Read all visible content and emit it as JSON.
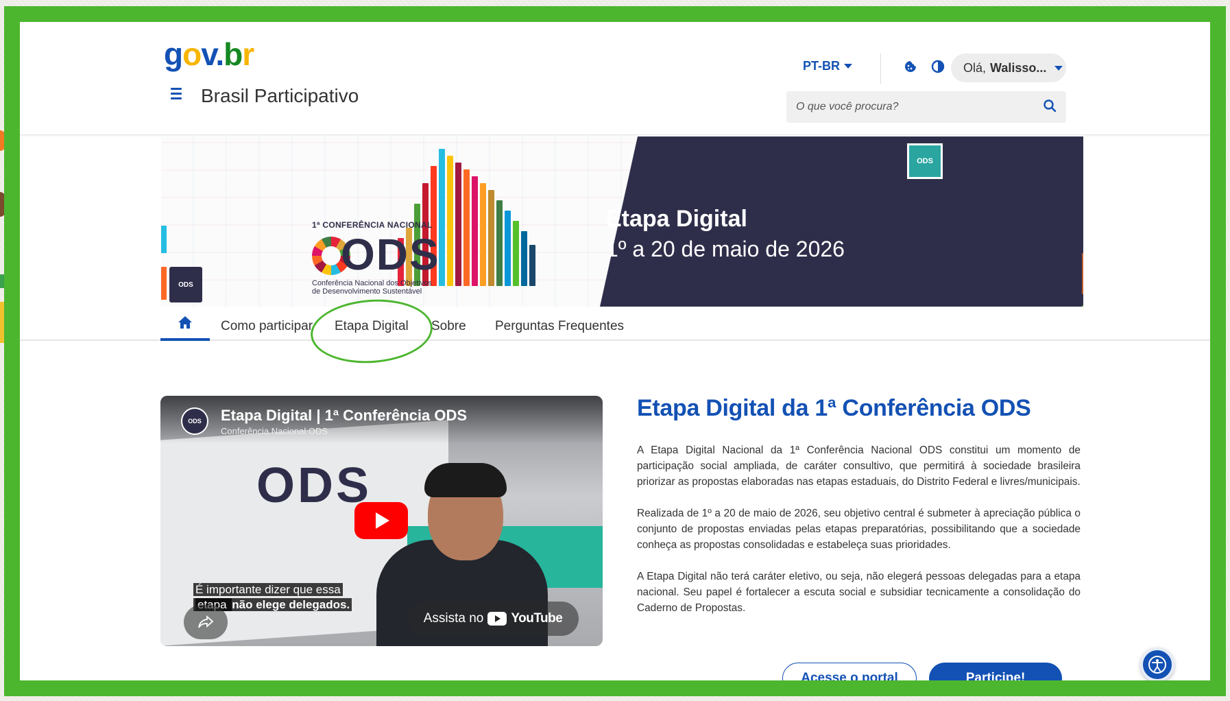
{
  "header": {
    "logo_text": "gov.br",
    "site_title": "Brasil Participativo",
    "language": "PT-BR",
    "user_greeting": "Olá,",
    "user_name": "Walisso...",
    "search_placeholder": "O que você procura?"
  },
  "banner": {
    "conference_label": "1ª CONFERÊNCIA NACIONAL",
    "ods_word": "ODS",
    "ods_subtitle_line1": "Conferência Nacional dos Objetivos",
    "ods_subtitle_line2": "de Desenvolvimento Sustentável",
    "title": "Etapa Digital",
    "date": "1º a 20 de maio de 2026",
    "badge": "ODS"
  },
  "nav": {
    "items": [
      {
        "label": "Como participar"
      },
      {
        "label": "Etapa Digital"
      },
      {
        "label": "Sobre"
      },
      {
        "label": "Perguntas Frequentes"
      }
    ]
  },
  "video": {
    "title": "Etapa Digital | 1ª Conferência ODS",
    "channel": "Conferência Nacional ODS",
    "caption_line1": "É importante dizer que essa",
    "caption_line2_a": "etapa ",
    "caption_line2_b": "não elege delegados.",
    "watch_on": "Assista no",
    "youtube": "YouTube",
    "poster_text": "ODS"
  },
  "article": {
    "heading": "Etapa Digital da 1ª Conferência ODS",
    "paragraphs": [
      "A Etapa Digital Nacional da 1ª Conferência Nacional ODS constitui um momento de participação social ampliada, de caráter consultivo, que permitirá à sociedade brasileira priorizar as propostas elaboradas nas etapas estaduais, do Distrito Federal e livres/municipais.",
      "Realizada de 1º a 20 de maio de 2026, seu objetivo central é submeter à apreciação pública o conjunto de propostas enviadas pelas etapas preparatórias, possibilitando que a sociedade conheça as propostas consolidadas e estabeleça suas prioridades.",
      "A Etapa Digital não terá caráter eletivo, ou seja, não elegerá pessoas delegadas para a etapa nacional. Seu papel é fortalecer a escuta social e subsidiar tecnicamente a consolidação do Caderno de Propostas."
    ]
  },
  "buttons": {
    "portal": "Acesse o portal",
    "participate": "Participe!"
  },
  "colors": {
    "primary": "#1351b4",
    "highlight_green": "#4cb62f",
    "banner_dark": "#2f2e4a"
  },
  "icons": {
    "menu": "hamburger-icon",
    "search": "search-icon",
    "cookie": "cookie-icon",
    "contrast": "contrast-icon",
    "home": "home-icon",
    "accessibility": "accessibility-icon",
    "share": "share-icon",
    "play": "play-icon"
  }
}
